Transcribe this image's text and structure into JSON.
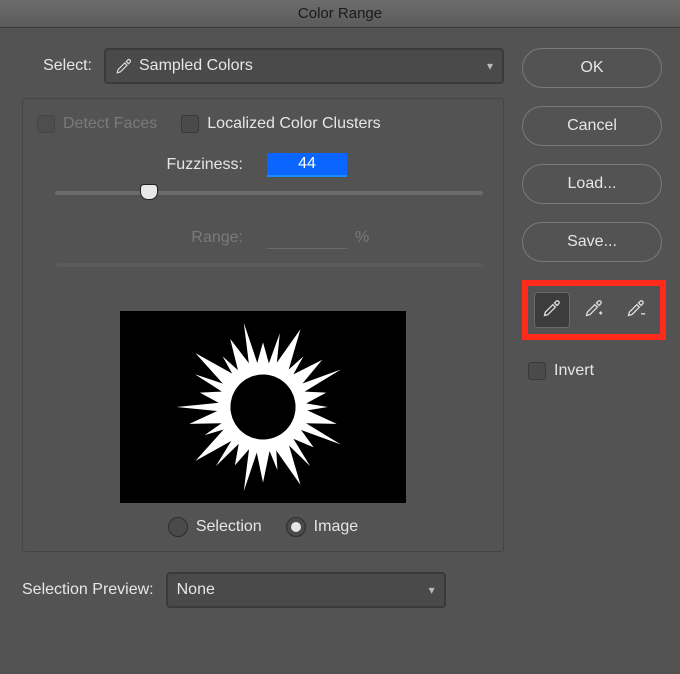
{
  "window": {
    "title": "Color Range"
  },
  "select": {
    "label": "Select:",
    "value": "Sampled Colors"
  },
  "options": {
    "detect_faces_label": "Detect Faces",
    "localized_clusters_label": "Localized Color Clusters"
  },
  "fuzziness": {
    "label": "Fuzziness:",
    "value": "44",
    "slider_percent": 22
  },
  "range": {
    "label": "Range:",
    "unit": "%"
  },
  "preview_mode": {
    "selection_label": "Selection",
    "image_label": "Image",
    "selected": "image"
  },
  "buttons": {
    "ok": "OK",
    "cancel": "Cancel",
    "load": "Load...",
    "save": "Save..."
  },
  "invert": {
    "label": "Invert"
  },
  "footer": {
    "label": "Selection Preview:",
    "value": "None"
  }
}
